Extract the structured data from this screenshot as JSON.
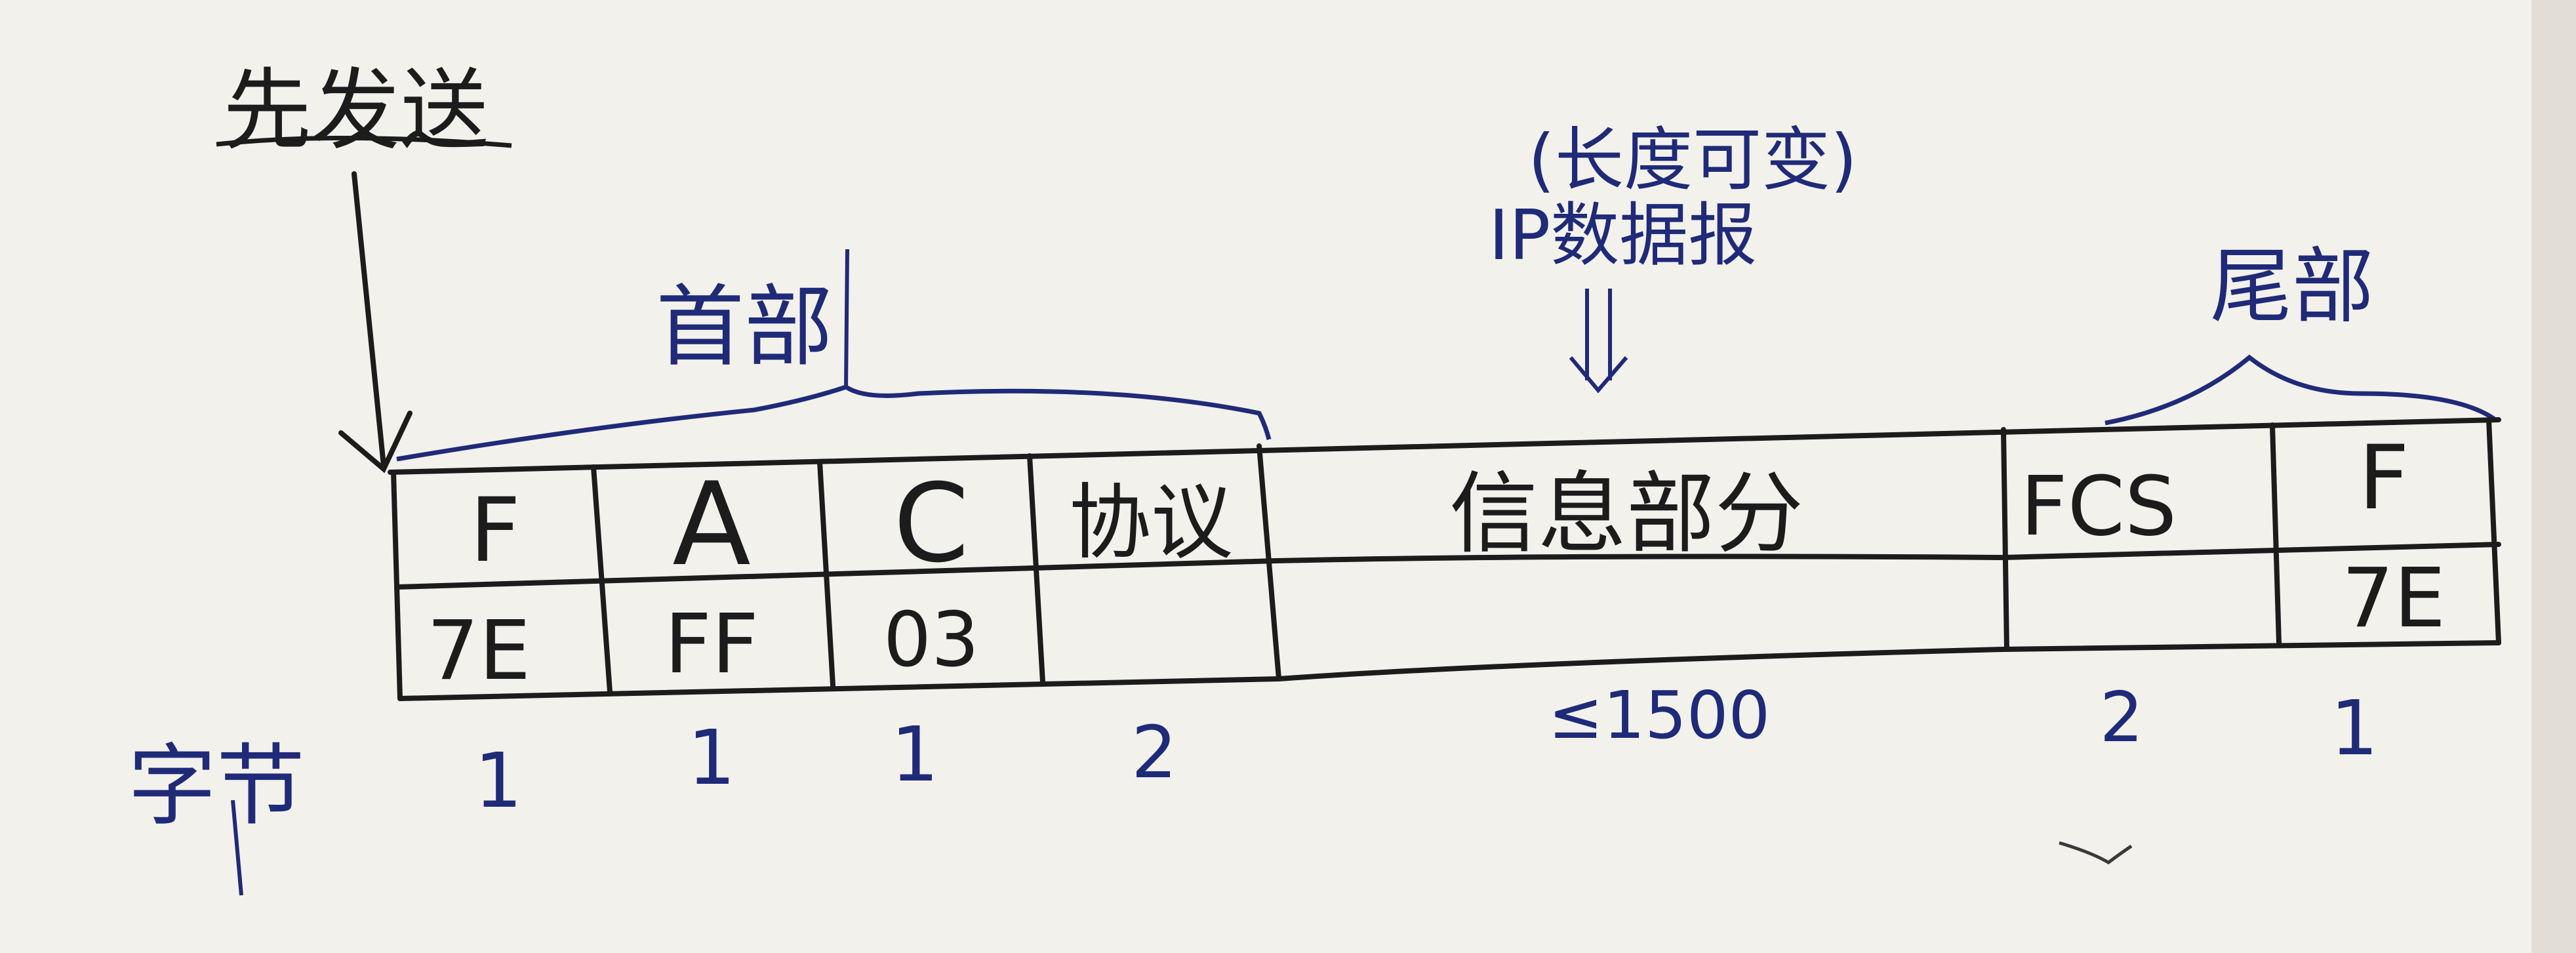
{
  "labels": {
    "send_first": "先发送",
    "header": "首部",
    "trailer": "尾部",
    "payload_note": "(长度可变)",
    "payload_type": "IP数据报",
    "bytes_row_label": "字节"
  },
  "fields": [
    {
      "name": "F",
      "value": "7E",
      "bytes": "1"
    },
    {
      "name": "A",
      "value": "FF",
      "bytes": "1"
    },
    {
      "name": "C",
      "value": "03",
      "bytes": "1"
    },
    {
      "name": "协议",
      "value": "",
      "bytes": "2"
    },
    {
      "name": "信息部分",
      "value": "",
      "bytes": "≤1500"
    },
    {
      "name": "FCS",
      "value": "",
      "bytes": "2"
    },
    {
      "name": "F",
      "value": "7E",
      "bytes": "1"
    }
  ],
  "colors": {
    "paper": "#f3f1ec",
    "black_ink": "#1c1c1c",
    "blue_ink": "#1f2a78"
  },
  "icons": {
    "down_arrow": "down-arrow-icon",
    "double_down_arrow": "double-arrow-down-icon"
  }
}
